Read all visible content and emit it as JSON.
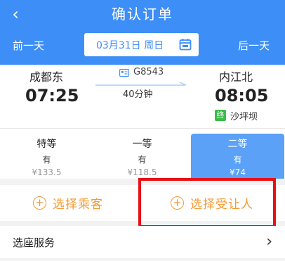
{
  "header": {
    "title": "确认订单",
    "back_icon": "chevron-left-icon",
    "prev_day": "前一天",
    "next_day": "后一天",
    "date": "03月31日 周日",
    "calendar_icon": "calendar-icon",
    "bg_color": "#3d8ef6"
  },
  "train": {
    "from_station": "成都东",
    "from_time": "07:25",
    "to_station": "内江北",
    "to_time": "08:05",
    "train_no": "G8543",
    "duration": "40分钟",
    "terminal_badge": "终",
    "terminal_station": "沙坪坝"
  },
  "seats": [
    {
      "name": "特等",
      "avail": "有",
      "price": "¥133.5",
      "selected": false
    },
    {
      "name": "一等",
      "avail": "有",
      "price": "¥118.5",
      "selected": false
    },
    {
      "name": "二等",
      "avail": "有",
      "price": "¥74",
      "selected": true
    }
  ],
  "actions": {
    "add_passenger": "选择乘客",
    "add_beneficiary": "选择受让人",
    "accent_color": "#f39a37"
  },
  "service": {
    "label": "选座服务"
  }
}
